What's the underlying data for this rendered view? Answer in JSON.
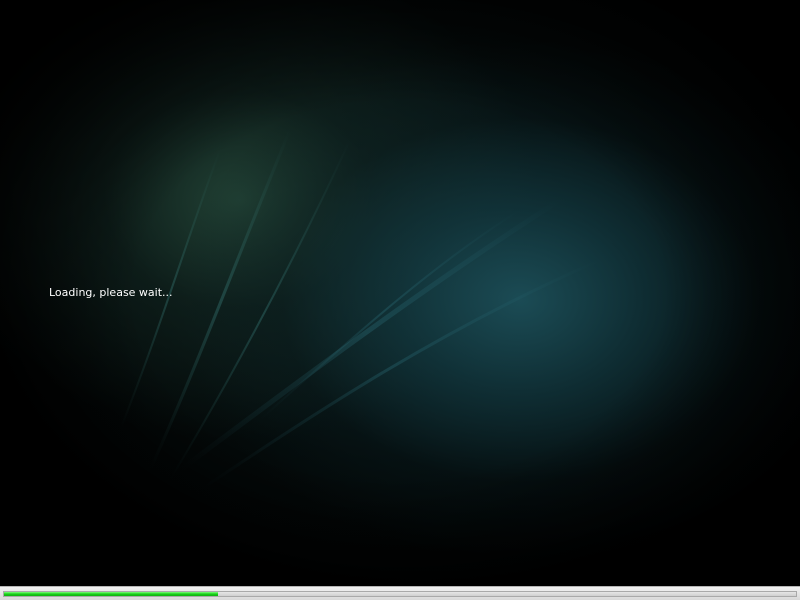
{
  "loading": {
    "message": "Loading, please wait..."
  },
  "progress": {
    "fraction": 0.27,
    "fill_color": "#19d219"
  },
  "background": {
    "accent_color": "#1c4e58"
  }
}
